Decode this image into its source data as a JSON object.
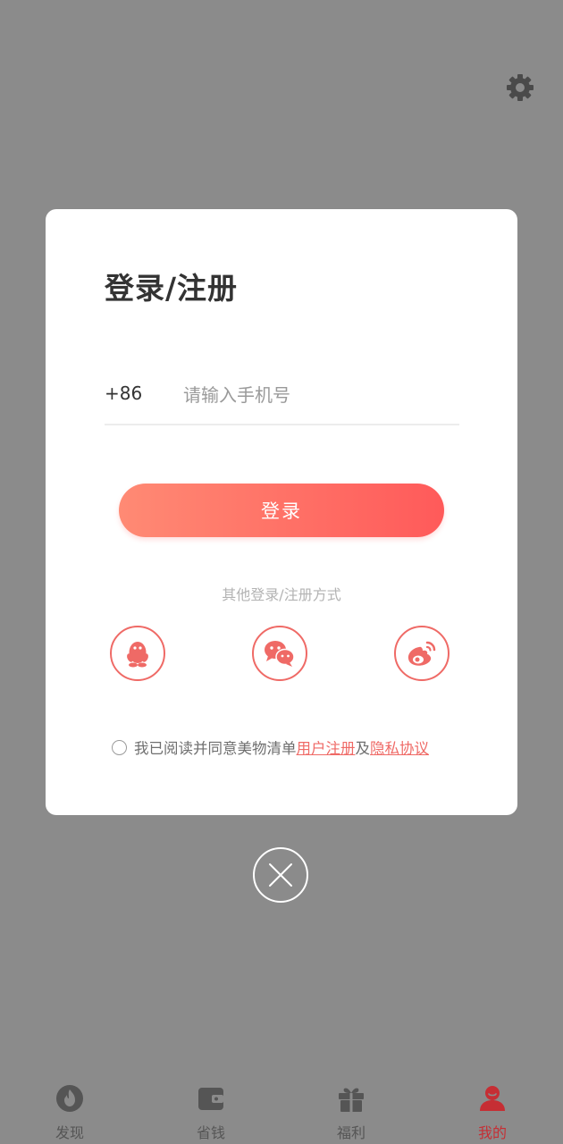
{
  "dialog": {
    "title": "登录/注册",
    "country_code": "+86",
    "phone_placeholder": "请输入手机号",
    "phone_value": "",
    "login_label": "登录",
    "other_methods_label": "其他登录/注册方式",
    "social_logins": [
      "qq-icon",
      "wechat-icon",
      "weibo-icon"
    ],
    "agreement": {
      "prefix": "我已阅读并同意美物清单 ",
      "user_terms": "用户注册",
      "connector": "及",
      "privacy": "隐私协议",
      "checked": false
    }
  },
  "tabbar": {
    "tabs": [
      {
        "label": "发现",
        "icon": "flame-icon",
        "active": false
      },
      {
        "label": "省钱",
        "icon": "wallet-icon",
        "active": false
      },
      {
        "label": "福利",
        "icon": "gift-icon",
        "active": false
      },
      {
        "label": "我的",
        "icon": "user-icon",
        "active": true
      }
    ]
  },
  "colors": {
    "accent": "#ef6a66",
    "button_gradient_start": "#ff8a74",
    "button_gradient_end": "#ff5a5a",
    "overlay": "#8b8b8b",
    "active_tab": "#c62e34"
  }
}
